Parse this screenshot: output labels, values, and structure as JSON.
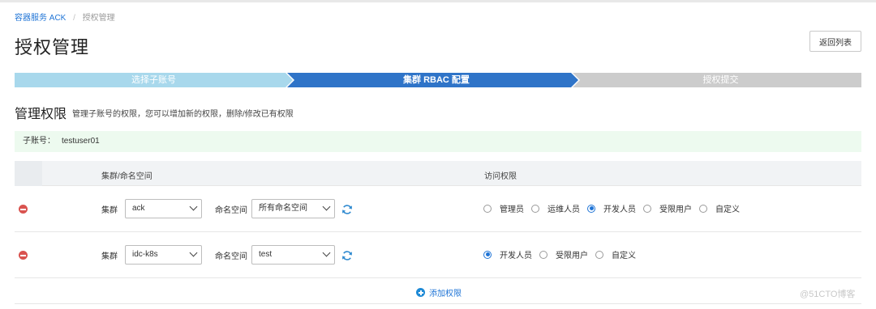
{
  "breadcrumb": {
    "parent": "容器服务 ACK",
    "separator": "/",
    "current": "授权管理"
  },
  "page": {
    "title": "授权管理",
    "back_button": "返回列表"
  },
  "steps": [
    {
      "label": "选择子账号",
      "state": "done",
      "color": "#a8d8ec"
    },
    {
      "label": "集群 RBAC 配置",
      "state": "active",
      "color": "#2f74c8"
    },
    {
      "label": "授权提交",
      "state": "pending",
      "color": "#cccccc"
    }
  ],
  "section": {
    "title": "管理权限",
    "description": "管理子账号的权限，您可以增加新的权限，删除/修改已有权限"
  },
  "account": {
    "label": "子账号：",
    "value": "testuser01"
  },
  "table": {
    "headers": [
      "集群/命名空间",
      "访问权限"
    ],
    "cluster_label": "集群",
    "namespace_label": "命名空间",
    "rows": [
      {
        "cluster": "ack",
        "namespace": "所有命名空间",
        "roles": [
          {
            "label": "管理员",
            "checked": false
          },
          {
            "label": "运维人员",
            "checked": false
          },
          {
            "label": "开发人员",
            "checked": true
          },
          {
            "label": "受限用户",
            "checked": false
          },
          {
            "label": "自定义",
            "checked": false
          }
        ]
      },
      {
        "cluster": "idc-k8s",
        "namespace": "test",
        "roles": [
          {
            "label": "开发人员",
            "checked": true
          },
          {
            "label": "受限用户",
            "checked": false
          },
          {
            "label": "自定义",
            "checked": false
          }
        ]
      }
    ]
  },
  "add_permission": "添加权限",
  "watermark": "@51CTO博客",
  "colors": {
    "link": "#1f74d6",
    "remove": "#d9534f",
    "success_bg": "#edfaef"
  }
}
